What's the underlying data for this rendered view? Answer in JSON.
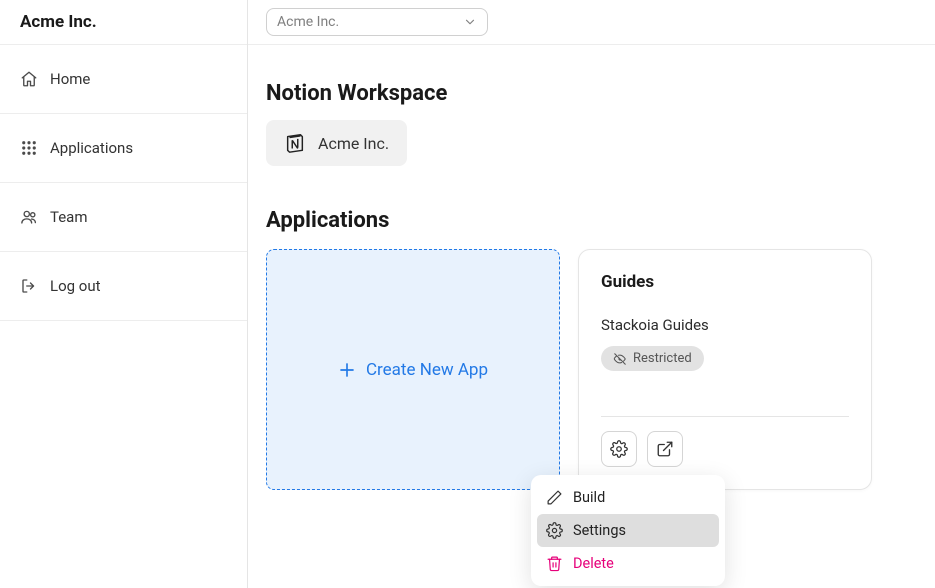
{
  "sidebar": {
    "title": "Acme Inc.",
    "items": [
      {
        "label": "Home"
      },
      {
        "label": "Applications"
      },
      {
        "label": "Team"
      },
      {
        "label": "Log out"
      }
    ]
  },
  "workspace_select": {
    "value": "Acme Inc."
  },
  "sections": {
    "workspace_title": "Notion Workspace",
    "workspace_name": "Acme Inc.",
    "applications_title": "Applications"
  },
  "create_card": {
    "label": "Create New App"
  },
  "app_card": {
    "title": "Guides",
    "subtitle": "Stackoia Guides",
    "badge": "Restricted"
  },
  "dropdown": {
    "build": "Build",
    "settings": "Settings",
    "delete": "Delete"
  }
}
